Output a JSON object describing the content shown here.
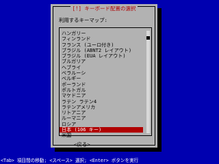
{
  "dialog": {
    "title": "[!] キーボード配置の選択",
    "prompt": "利用するキーマップ:",
    "items": [
      {
        "label": "ハンガリー",
        "selected": false
      },
      {
        "label": "フィンランド",
        "selected": false
      },
      {
        "label": "フランス (ユーロ付き)",
        "selected": false
      },
      {
        "label": "ブラジル (ABNT2 レイアウト)",
        "selected": false
      },
      {
        "label": "ブラジル (EUA レイアウト)",
        "selected": false
      },
      {
        "label": "ブルガリア",
        "selected": false
      },
      {
        "label": "ヘブライ",
        "selected": false
      },
      {
        "label": "ベラルーシ",
        "selected": false
      },
      {
        "label": "ベルギー",
        "selected": false
      },
      {
        "label": "ポーランド",
        "selected": false
      },
      {
        "label": "ポルトガル",
        "selected": false
      },
      {
        "label": "マケドニア",
        "selected": false
      },
      {
        "label": "ラテン ラテン4",
        "selected": false
      },
      {
        "label": "ラテンアメリカ",
        "selected": false
      },
      {
        "label": "リトアニア",
        "selected": false
      },
      {
        "label": "ルーマニア",
        "selected": false
      },
      {
        "label": "ロシア",
        "selected": false
      },
      {
        "label": "日本 (106 キー)",
        "selected": true
      },
      {
        "label": "米国",
        "selected": false
      }
    ],
    "back_label": "<戻る>"
  },
  "status_bar": {
    "text": "<Tab> 項目間の移動; <スペース> 選択; <Enter> ボタンを実行"
  },
  "scrollbar": {
    "thumb_start_fraction": 0.05,
    "thumb_size_fraction": 0.03
  },
  "colors": {
    "background": "#0000b0",
    "dialog": "#b2b2b2",
    "title": "#b00000",
    "selected": "#b00000"
  }
}
